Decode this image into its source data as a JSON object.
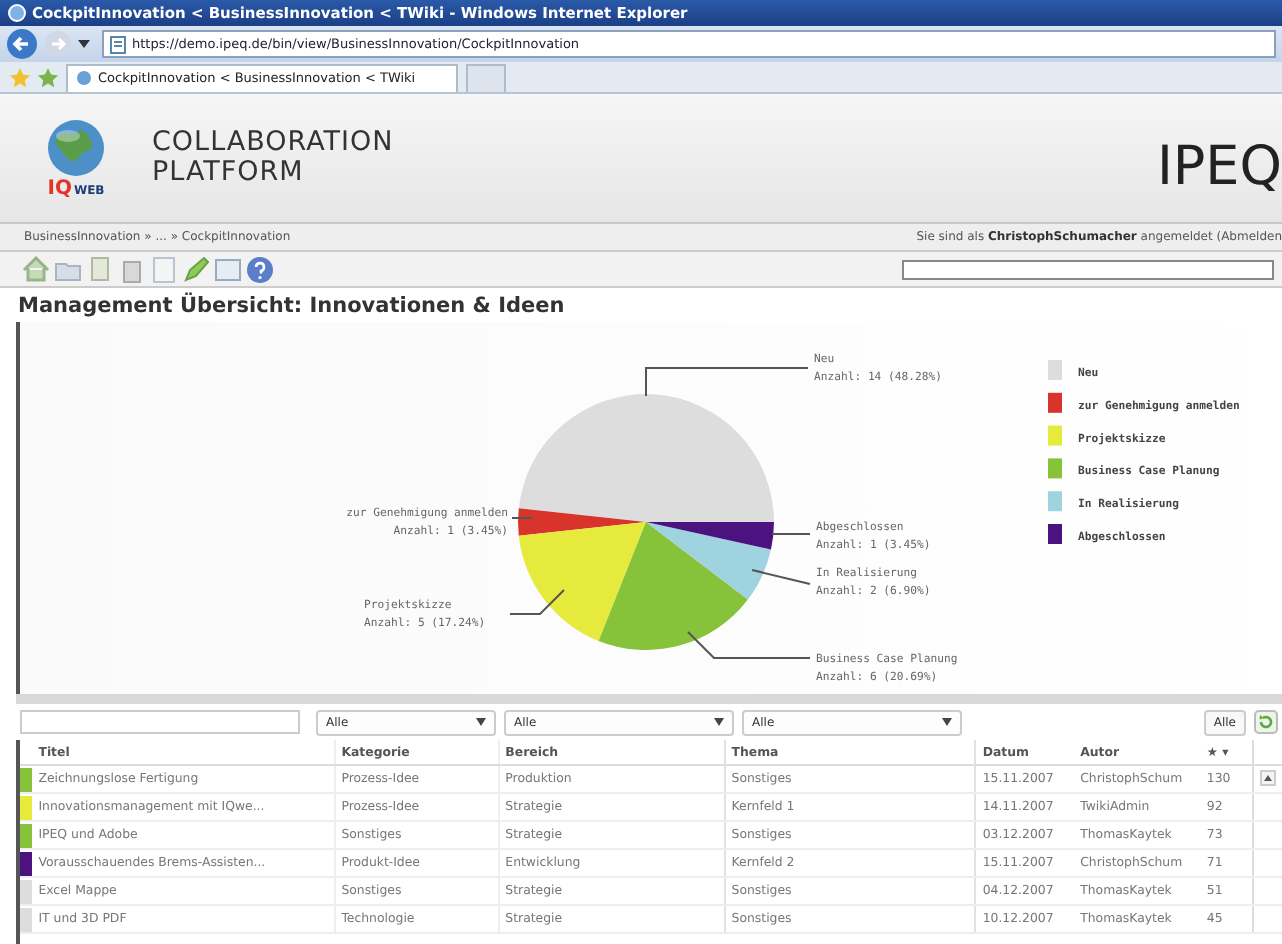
{
  "window": {
    "title": "CockpitInnovation < BusinessInnovation < TWiki - Windows Internet Explorer"
  },
  "address_bar": {
    "url": "https://demo.ipeq.de/bin/view/BusinessInnovation/CockpitInnovation"
  },
  "browser_tabs": [
    {
      "label": "CockpitInnovation < BusinessInnovation < TWiki",
      "selected": true
    }
  ],
  "header": {
    "logo_text": "IQ",
    "logo_sub": "WEB",
    "title_lines": [
      "COLLABORATION",
      "PLATFORM"
    ],
    "brand": "IPEQ"
  },
  "breadcrumb": "BusinessInnovation » ... » CockpitInnovation",
  "user_note": "Sie sind als **ChristophSchumacher** angemeldet (Abmelden",
  "heading": "Management Übersicht: Innovationen & Ideen",
  "chart": {
    "chart_data": {
      "type": "pie",
      "categories": [
        "Neu",
        "zur Genehmigung anmelden",
        "Projektskizze",
        "Business Case Planung",
        "In Realisierung",
        "Abgeschlossen"
      ],
      "values": [
        48.28,
        3.45,
        17.24,
        20.69,
        6.9,
        3.45
      ],
      "legend": "right"
    },
    "slice_labels": [
      {
        "name": "Neu",
        "count": "Anzahl: 14 (48.28%)"
      },
      {
        "name": "zur Genehmigung anmelden",
        "count": "Anzahl: 1 (3.45%)"
      },
      {
        "name": "Abgeschlossen",
        "count": "Anzahl: 1 (3.45%)"
      },
      {
        "name": "In Realisierung",
        "count": "Anzahl: 2 (6.90%)"
      },
      {
        "name": "Projektskizze",
        "count": "Anzahl: 5 (17.24%)"
      },
      {
        "name": "Business Case Planung",
        "count": "Anzahl: 6 (20.69%)"
      }
    ],
    "slice_colors": [
      {
        "color": "#dddddd"
      },
      {
        "color": "#d9342b"
      },
      {
        "color": "#e6ea3c"
      },
      {
        "color": "#86c23a"
      },
      {
        "color": "#9fd3e0"
      },
      {
        "color": "#4a1380"
      }
    ]
  },
  "filters": [
    {
      "value": "Alle"
    },
    {
      "value": "Alle"
    },
    {
      "value": "Alle"
    }
  ],
  "filter_all_button": "Alle",
  "table": {
    "columns": [
      "Titel",
      "Kategorie",
      "Bereich",
      "Thema",
      "Datum",
      "Autor",
      "★ ▾"
    ],
    "rows": [
      {
        "color": "#86c23a",
        "cells": [
          "Zeichnungslose Fertigung",
          "Prozess-Idee",
          "Produktion",
          "Sonstiges",
          "15.11.2007",
          "ChristophSchum",
          "130"
        ]
      },
      {
        "color": "#e6ea3c",
        "cells": [
          "Innovationsmanagement mit IQwe...",
          "Prozess-Idee",
          "Strategie",
          "Kernfeld 1",
          "14.11.2007",
          "TwikiAdmin",
          "92"
        ]
      },
      {
        "color": "#86c23a",
        "cells": [
          "IPEQ und Adobe",
          "Sonstiges",
          "Strategie",
          "Sonstiges",
          "03.12.2007",
          "ThomasKaytek",
          "73"
        ]
      },
      {
        "color": "#4a1380",
        "cells": [
          "Vorausschauendes Brems-Assisten...",
          "Produkt-Idee",
          "Entwicklung",
          "Kernfeld 2",
          "15.11.2007",
          "ChristophSchum",
          "71"
        ]
      },
      {
        "color": "#dddddd",
        "cells": [
          "Excel Mappe",
          "Sonstiges",
          "Strategie",
          "Sonstiges",
          "04.12.2007",
          "ThomasKaytek",
          "51"
        ]
      },
      {
        "color": "#dddddd",
        "cells": [
          "IT und 3D PDF",
          "Technologie",
          "Strategie",
          "Sonstiges",
          "10.12.2007",
          "ThomasKaytek",
          "45"
        ]
      }
    ]
  }
}
